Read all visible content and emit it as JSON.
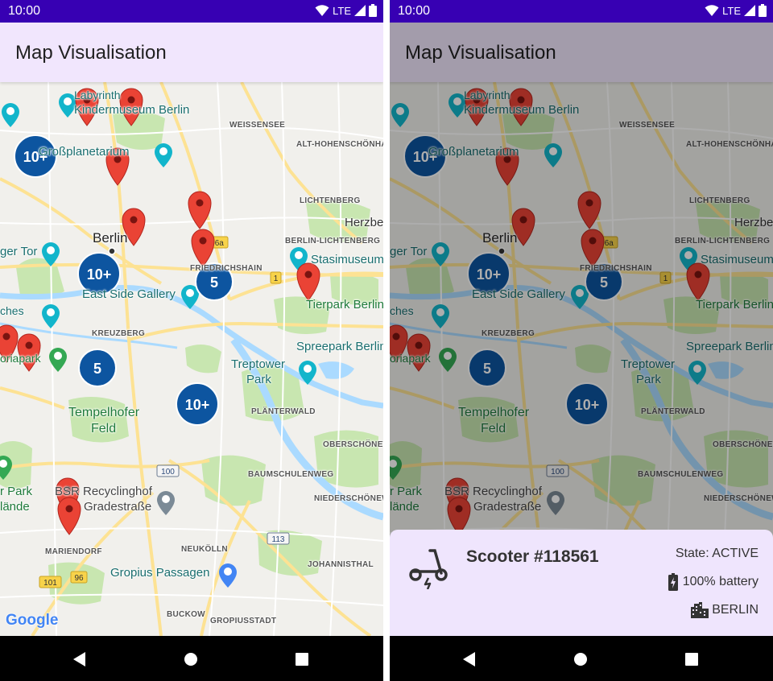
{
  "status_bar": {
    "time": "10:00",
    "network": "LTE"
  },
  "app_bar": {
    "title": "Map Visualisation"
  },
  "map": {
    "places": {
      "labyrinth": "Labyrinth",
      "kindermuseum": "Kindermuseum Berlin",
      "weissensee": "WEISSENSEE",
      "grossplanetarium": "Großplanetarium",
      "alt_hohenschoenhausen": "ALT-HOHENSCHÖNHAUSEN",
      "lichtenberg": "LICHTENBERG",
      "herzberge": "Herzbe",
      "berlin": "Berlin",
      "berlin_lichtenberg": "BERLIN-LICHTENBERG",
      "stasimuseum": "Stasimuseum",
      "brandenburger_tor": "ger Tor",
      "friedrichshain": "FRIEDRICHSHAIN",
      "east_side_gallery": "East Side Gallery",
      "tierpark": "Tierpark Berlin",
      "ruins": "ches",
      "kreuzberg": "KREUZBERG",
      "spreepark": "Spreepark Berlin",
      "viktoriapark": "oriapark",
      "treptower_park_1": "Treptower",
      "treptower_park_2": "Park",
      "tempelhofer_1": "Tempelhofer",
      "tempelhofer_2": "Feld",
      "plaenterwald": "PLÄNTERWALD",
      "oberschoeneweide": "OBERSCHÖNEWE",
      "baumschulenweg": "BAUMSCHULENWEG",
      "park_gelaende_1": "r Park",
      "park_gelaende_2": "lände",
      "bsr_1": "BSR Recyclinghof",
      "bsr_2": "Gradestraße",
      "niederschoeneweide": "NIEDERSCHÖNEWE",
      "mariendorf": "MARIENDORF",
      "neukoelln": "NEUKÖLLN",
      "gropius": "Gropius Passagen",
      "johannisthal": "JOHANNISTHAL",
      "buckow": "BUCKOW",
      "gropiusstadt": "GROPIUSSTADT"
    },
    "road_shields": [
      "96a",
      "1",
      "100",
      "113",
      "101",
      "96"
    ],
    "clusters": [
      "10+",
      "10+",
      "5",
      "5",
      "10+"
    ],
    "google_logo": "Google",
    "water_color": "#aadaff",
    "park_color": "#c8e6b0",
    "road_color": "#fde293",
    "marker_color": "#ea4335",
    "cluster_color": "#0d55a0"
  },
  "sheet": {
    "scooter_name": "Scooter #118561",
    "state": "State: ACTIVE",
    "battery": "100% battery",
    "city": "BERLIN",
    "icon": "electric-scooter-icon"
  },
  "nav": {
    "back_icon": "back-triangle-icon",
    "home_icon": "home-circle-icon",
    "recent_icon": "recent-square-icon"
  }
}
